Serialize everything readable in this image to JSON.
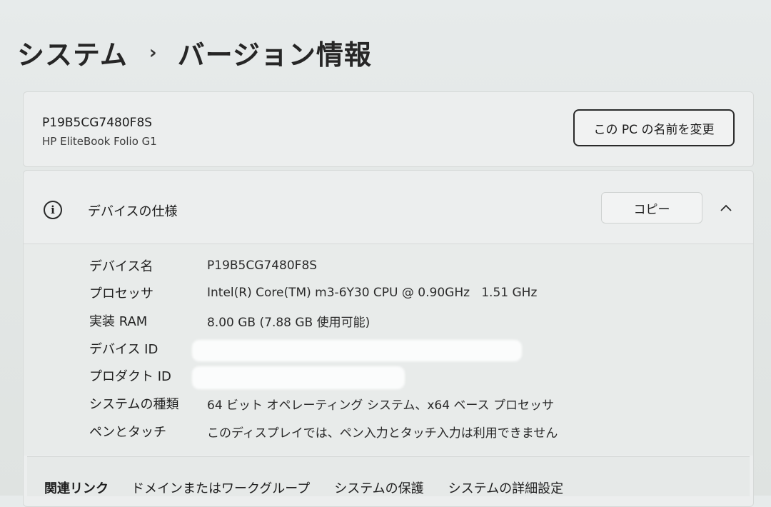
{
  "breadcrumb": {
    "parent": "システム",
    "separator": "›",
    "current": "バージョン情報"
  },
  "device_card": {
    "pc_name": "P19B5CG7480F8S",
    "model": "HP EliteBook Folio G1",
    "rename_button": "この PC の名前を変更"
  },
  "spec_section": {
    "icon": "info-icon",
    "title": "デバイスの仕様",
    "copy_button": "コピー",
    "collapse_icon": "chevron-up-icon",
    "rows": [
      {
        "label": "デバイス名",
        "value": "P19B5CG7480F8S"
      },
      {
        "label": "プロセッサ",
        "value": "Intel(R) Core(TM) m3-6Y30 CPU @ 0.90GHz   1.51 GHz"
      },
      {
        "label": "実装 RAM",
        "value": "8.00 GB (7.88 GB 使用可能)"
      },
      {
        "label": "デバイス ID",
        "value": ""
      },
      {
        "label": "プロダクト ID",
        "value": ""
      },
      {
        "label": "システムの種類",
        "value": "64 ビット オペレーティング システム、x64 ベース プロセッサ"
      },
      {
        "label": "ペンとタッチ",
        "value": "このディスプレイでは、ペン入力とタッチ入力は利用できません"
      }
    ]
  },
  "related_links": {
    "label": "関連リンク",
    "links": [
      "ドメインまたはワークグループ",
      "システムの保護",
      "システムの詳細設定"
    ]
  }
}
